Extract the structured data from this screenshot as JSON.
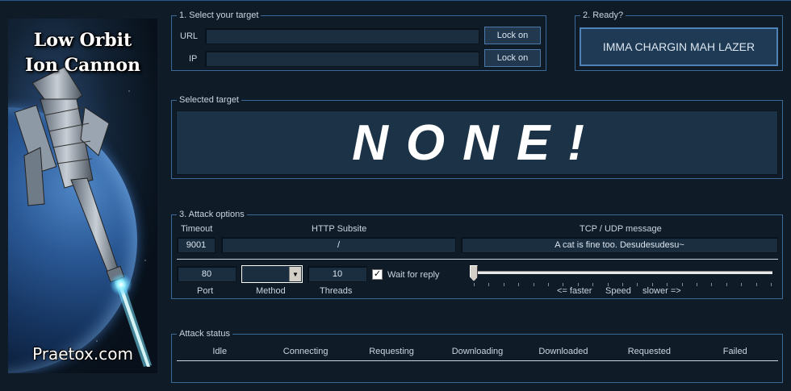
{
  "banner": {
    "title_line1": "Low Orbit",
    "title_line2": "Ion Cannon",
    "site": "Praetox.com"
  },
  "target_group": {
    "legend": "1. Select your target",
    "url_label": "URL",
    "url_value": "",
    "ip_label": "IP",
    "ip_value": "",
    "url_lock_button": "Lock on",
    "ip_lock_button": "Lock on"
  },
  "ready_group": {
    "legend": "2. Ready?",
    "fire_button": "IMMA CHARGIN MAH LAZER"
  },
  "selected_target": {
    "legend": "Selected target",
    "value": "NONE!"
  },
  "attack_options": {
    "legend": "3. Attack options",
    "timeout_label": "Timeout",
    "timeout_value": "9001",
    "http_subsite_label": "HTTP Subsite",
    "http_subsite_value": "/",
    "message_label": "TCP / UDP message",
    "message_value": "A cat is fine too. Desudesudesu~",
    "port_value": "80",
    "port_label": "Port",
    "method_value": "",
    "method_label": "Method",
    "threads_value": "10",
    "threads_label": "Threads",
    "wait_for_reply_label": "Wait for reply",
    "wait_for_reply_checked": true,
    "speed_faster": "<= faster",
    "speed_label": "Speed",
    "speed_slower": "slower =>",
    "speed_value_fraction": 0.0
  },
  "attack_status": {
    "legend": "Attack status",
    "columns": [
      "Idle",
      "Connecting",
      "Requesting",
      "Downloading",
      "Downloaded",
      "Requested",
      "Failed"
    ]
  },
  "colors": {
    "background": "#0f1c28",
    "field": "#1a2e40",
    "border": "#3c6a98",
    "text": "#c9d6e2"
  }
}
